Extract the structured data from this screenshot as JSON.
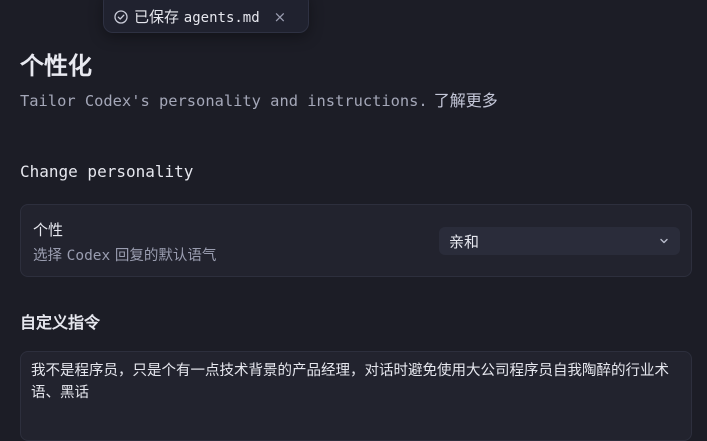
{
  "toast": {
    "prefix": "已保存",
    "filename": "agents.md",
    "close": "×",
    "icon": "check-circle-icon"
  },
  "header": {
    "title": "个性化",
    "description": "Tailor Codex's personality and instructions.",
    "learn_more": "了解更多"
  },
  "personality": {
    "section_title": "Change personality",
    "label": "个性",
    "hint_prefix": "选择",
    "hint_brand": "Codex",
    "hint_suffix": "回复的默认语气",
    "selected": "亲和",
    "chevron_icon": "chevron-down-icon"
  },
  "custom_instructions": {
    "title": "自定义指令",
    "value": "我不是程序员，只是个有一点技术背景的产品经理，对话时避免使用大公司程序员自我陶醉的行业术语、黑话"
  },
  "colors": {
    "background": "#1c1d26",
    "card": "#22232e",
    "border": "#2d2f3d",
    "text": "#e6e7ee",
    "muted": "#9a9db0"
  }
}
